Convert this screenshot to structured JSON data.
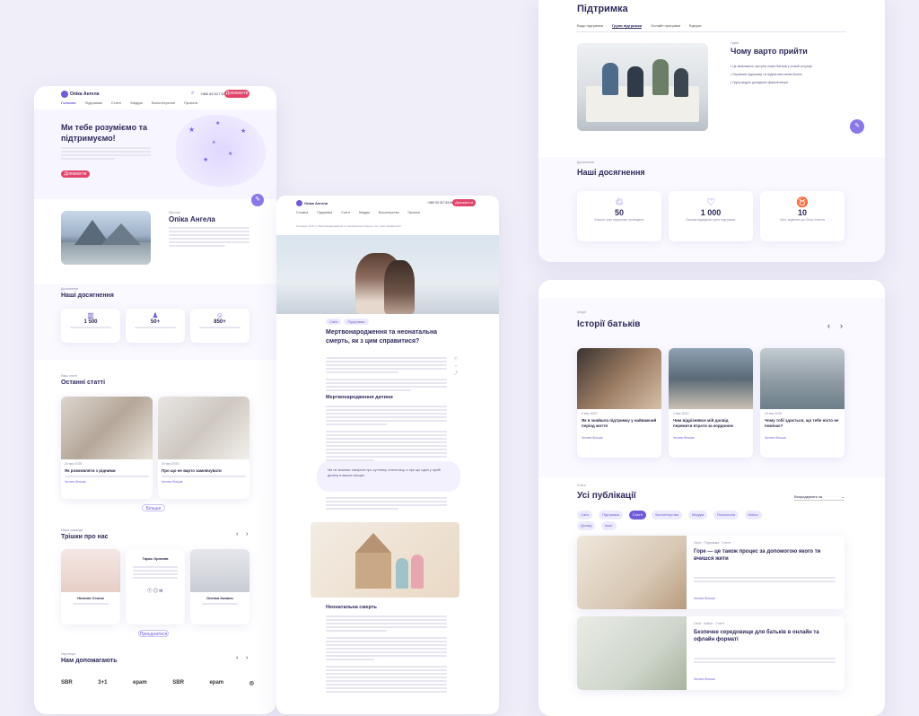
{
  "brand": {
    "logo_text": "Опіка Ангела",
    "phone": "+380 93 017 63 66",
    "donate_label": "Допомогти"
  },
  "nav": [
    "Головна",
    "Підтримка",
    "Статті",
    "Медіум",
    "Волонтерство",
    "Проєкти"
  ],
  "hero": {
    "title": "Ми тебе розуміємо та підтримуємо!",
    "cta": "Допомогти"
  },
  "about": {
    "label": "Про нас",
    "title": "Опіка Ангела"
  },
  "achievements_left": {
    "label": "Досягнення",
    "title": "Наші досягнення",
    "items": [
      {
        "num": "1 500"
      },
      {
        "num": "50+"
      },
      {
        "num": "850+"
      }
    ]
  },
  "articles": {
    "label": "Наші статті",
    "title": "Останні статті",
    "cards": [
      {
        "date": "20 вер 2020",
        "title": "Як розмовляти з рідними",
        "link": "Читати більше"
      },
      {
        "date": "20 вер 2020",
        "title": "Про що не варто замовчувати",
        "link": "Читати більше"
      }
    ],
    "more": "Більше"
  },
  "team": {
    "label": "Наша команда",
    "title": "Трішки про нас",
    "members": [
      {
        "name": "Наталія Січник"
      },
      {
        "name": "Тарас Орловів"
      },
      {
        "name": "Оленка Коваль"
      }
    ],
    "more": "Приєднатися"
  },
  "partners": {
    "label": "Партнери",
    "title": "Нам допомагають",
    "logos": [
      "SBR",
      "3+1",
      "epam",
      "SBR",
      "epam",
      "◎"
    ]
  },
  "article": {
    "breadcrumb": "Головна / Статті / Мертвонародження та неонатальна смерть, як з цим справитися?",
    "title": "Мертвонародження та неонатальна смерть, як з цим справитися?",
    "h2": "Мертвонародження дитини",
    "quote": "Ми не можемо говорити про суттєвну статистику, а про ще один у пробі дитину в ваших серцях.",
    "h3": "Неонатальна смерть"
  },
  "support": {
    "title": "Підтримка",
    "tabs": [
      "Види підтримки",
      "Групи підтримки",
      "Онлайн програми",
      "Відгуки"
    ],
    "why_label": "Групи",
    "why_title": "Чому варто прийти",
    "bullets": [
      "Це можливість зустріти інших батьків у схожій ситуації.",
      "Отримати підтримку та поділитися своїм болем",
      "Групу ведуть досвідчені фасилітатори."
    ]
  },
  "achievements_right": {
    "label": "Досягнення",
    "title": "Наші досягнення",
    "items": [
      {
        "num": "50",
        "caption": "Більше груп підтримки проведено"
      },
      {
        "num": "1 000",
        "caption": "Батьків відвідали групи підтримки"
      },
      {
        "num": "10",
        "caption": "Міст, задіяних до Опіки Ангела"
      }
    ]
  },
  "stories": {
    "label": "Історії",
    "title": "Історії батьків",
    "cards": [
      {
        "date": "8 вер 2020",
        "title": "Як я знайшла підтримку у найважчий період життя",
        "link": "Читати більше"
      },
      {
        "date": "1 вер 2020",
        "title": "Чим відрізнявся мій досвід пережити втрати за кордоном",
        "link": "Читати більше"
      },
      {
        "date": "23 вер 2020",
        "title": "Чому тобі здається, що тебе ніхто не помічає?",
        "link": "Читати більше"
      }
    ]
  },
  "publications": {
    "label": "Статті",
    "title": "Усі публікації",
    "sort": "Впорядкувати за",
    "chips": [
      "Сім'я",
      "Підтримка",
      "Статті",
      "Волонтерство",
      "Медіум",
      "Психологія",
      "Кейси",
      "Досвід",
      "Інше"
    ],
    "items": [
      {
        "title": "Горе — це також процес за допомогою якого ти вчишся жити",
        "link": "Читати більше"
      },
      {
        "title": "Безпечне середовище для батьків в онлайн та офлайн форматі",
        "link": "Читати більше"
      }
    ]
  },
  "colors": {
    "accent": "#6e5cd8",
    "pink": "#e2446b",
    "bg": "#f0eef8"
  }
}
